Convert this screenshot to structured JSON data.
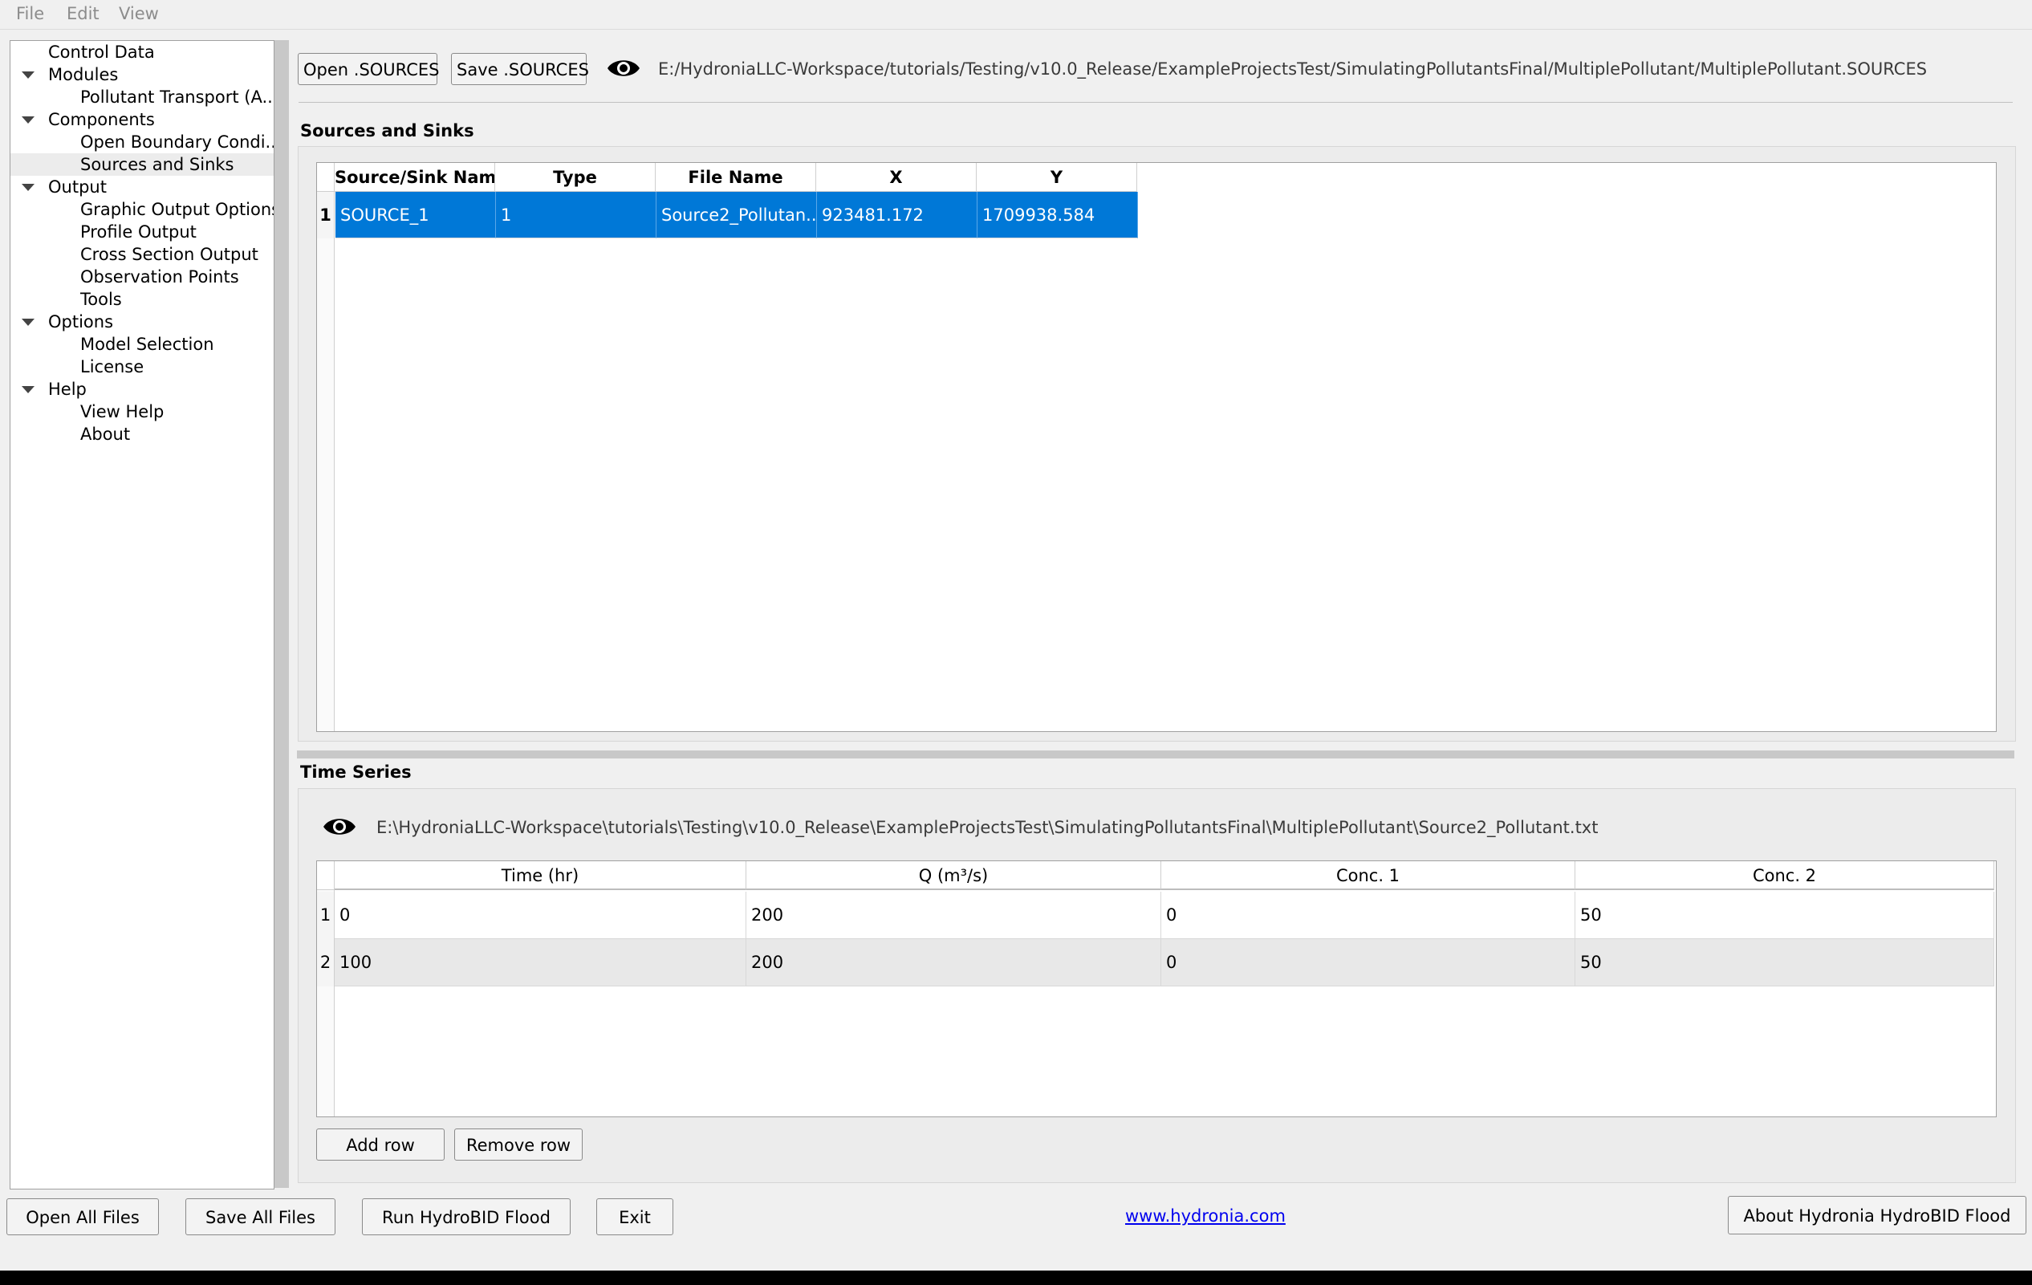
{
  "menu": [
    "File",
    "Edit",
    "View"
  ],
  "tree": [
    {
      "label": "Control Data",
      "level": 0,
      "expandable": false
    },
    {
      "label": "Modules",
      "level": 0,
      "expandable": true
    },
    {
      "label": "Pollutant Transport (A...",
      "level": 1,
      "expandable": false
    },
    {
      "label": "Components",
      "level": 0,
      "expandable": true
    },
    {
      "label": "Open Boundary Condi...",
      "level": 1,
      "expandable": false
    },
    {
      "label": "Sources and Sinks",
      "level": 1,
      "expandable": false,
      "selected": true
    },
    {
      "label": "Output",
      "level": 0,
      "expandable": true
    },
    {
      "label": "Graphic Output Options",
      "level": 1,
      "expandable": false
    },
    {
      "label": "Profile Output",
      "level": 1,
      "expandable": false
    },
    {
      "label": "Cross Section Output",
      "level": 1,
      "expandable": false
    },
    {
      "label": "Observation Points",
      "level": 1,
      "expandable": false
    },
    {
      "label": "Tools",
      "level": 1,
      "expandable": false
    },
    {
      "label": "Options",
      "level": 0,
      "expandable": true
    },
    {
      "label": "Model Selection",
      "level": 1,
      "expandable": false
    },
    {
      "label": "License",
      "level": 1,
      "expandable": false
    },
    {
      "label": "Help",
      "level": 0,
      "expandable": true
    },
    {
      "label": "View Help",
      "level": 1,
      "expandable": false
    },
    {
      "label": "About",
      "level": 1,
      "expandable": false
    }
  ],
  "toolbar": {
    "open_label": "Open .SOURCES",
    "save_label": "Save .SOURCES",
    "file_path": "E:/HydroniaLLC-Workspace/tutorials/Testing/v10.0_Release/ExampleProjectsTest/SimulatingPollutantsFinal/MultiplePollutant/MultiplePollutant.SOURCES"
  },
  "sources": {
    "title": "Sources and Sinks",
    "columns": [
      "Source/Sink Name",
      "Type",
      "File Name",
      "X",
      "Y"
    ],
    "rows": [
      {
        "num": "1",
        "cells": [
          "SOURCE_1",
          "1",
          "Source2_Pollutan...",
          "923481.172",
          "1709938.584"
        ]
      }
    ]
  },
  "timeseries": {
    "title": "Time Series",
    "file_path": "E:\\HydroniaLLC-Workspace\\tutorials\\Testing\\v10.0_Release\\ExampleProjectsTest\\SimulatingPollutantsFinal\\MultiplePollutant\\Source2_Pollutant.txt",
    "columns": [
      "Time (hr)",
      "Q (m³/s)",
      "Conc. 1",
      "Conc. 2"
    ],
    "rows": [
      {
        "num": "1",
        "cells": [
          "0",
          "200",
          "0",
          "50"
        ]
      },
      {
        "num": "2",
        "cells": [
          "100",
          "200",
          "0",
          "50"
        ]
      }
    ],
    "add_row": "Add row",
    "remove_row": "Remove row"
  },
  "footer": {
    "open_all": "Open All Files",
    "save_all": "Save All Files",
    "run": "Run HydroBID Flood",
    "exit": "Exit",
    "link": "www.hydronia.com",
    "about": "About Hydronia HydroBID Flood"
  },
  "colors": {
    "selection": "#0078d7",
    "link": "#0000ee"
  }
}
